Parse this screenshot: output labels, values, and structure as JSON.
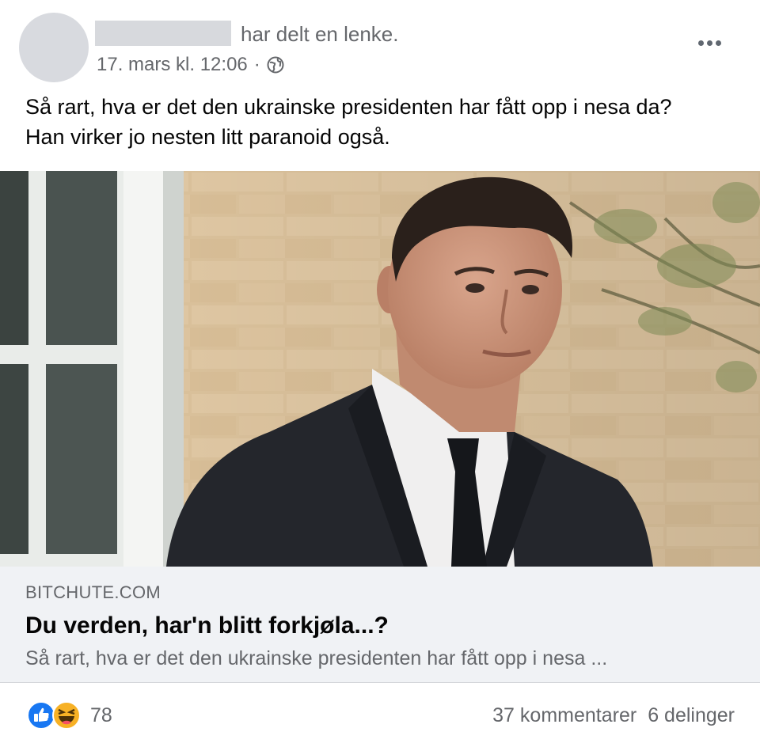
{
  "post": {
    "action_text": "har delt en lenke.",
    "timestamp": "17. mars kl. 12:06",
    "separator": "·",
    "privacy_icon": "globe-icon",
    "more_icon": "more-options-icon",
    "text_lines": [
      "Så rart, hva er det den ukrainske presidenten har fått opp i nesa da?",
      "Han virker jo nesten litt paranoid også."
    ]
  },
  "link": {
    "domain": "BITCHUTE.COM",
    "title": "Du verden, har'n blitt forkjøla...?",
    "description": "Så rart, hva er det den ukrainske presidenten har fått opp i nesa ..."
  },
  "footer": {
    "reaction_icons": [
      "like-icon",
      "haha-icon"
    ],
    "reaction_count": "78",
    "comments": "37 kommentarer",
    "shares": "6 delinger"
  },
  "colors": {
    "secondary_text": "#65676b",
    "link_preview_bg": "#f0f2f5",
    "like_blue": "#1877f2",
    "haha_yellow": "#f7b125"
  }
}
